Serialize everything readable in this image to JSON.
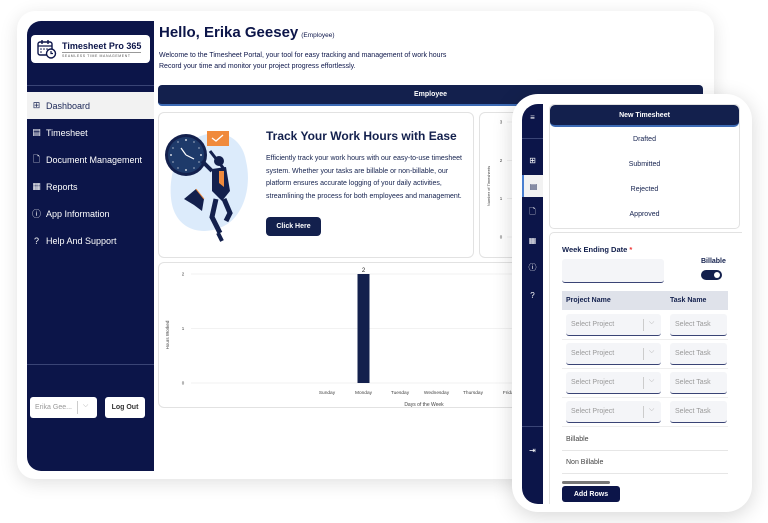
{
  "app": {
    "logo_title": "Timesheet Pro 365",
    "logo_subtitle": "SEAMLESS TIME MANAGEMENT"
  },
  "sidebar": {
    "items": [
      {
        "label": "Dashboard",
        "icon": "dashboard-icon",
        "active": true
      },
      {
        "label": "Timesheet",
        "icon": "timesheet-icon",
        "active": false
      },
      {
        "label": "Document Management",
        "icon": "document-icon",
        "active": false
      },
      {
        "label": "Reports",
        "icon": "reports-icon",
        "active": false
      },
      {
        "label": "App Information",
        "icon": "info-icon",
        "active": false
      },
      {
        "label": "Help And Support",
        "icon": "help-icon",
        "active": false
      }
    ],
    "user_select_value": "Erika Gee...",
    "logout_label": "Log Out"
  },
  "header": {
    "greeting": "Hello, Erika Geesey",
    "role": "(Employee)",
    "welcome_line1": "Welcome to the Timesheet Portal, your tool for easy tracking and management of work hours",
    "welcome_line2": "Record your time and monitor your project progress effortlessly."
  },
  "employee_bar": "Employee",
  "hero": {
    "title": "Track Your Work Hours with Ease",
    "text": "Efficiently track your work hours with our easy-to-use timesheet system. Whether your tasks are billable or non-billable, our platform ensures accurate logging of your daily activities, streamlining the process for both employees and management.",
    "button": "Click Here"
  },
  "chart_data": [
    {
      "type": "bar",
      "title": "",
      "xlabel": "Days of the Week",
      "ylabel": "Hours Worked",
      "categories": [
        "Sunday",
        "Monday",
        "Tuesday",
        "Wednesday",
        "Thursday",
        "Friday"
      ],
      "values": [
        0,
        2,
        0,
        0,
        0,
        0
      ],
      "data_labels": [
        "",
        "2",
        "",
        "",
        "",
        ""
      ],
      "yticks": [
        0,
        1,
        2
      ],
      "ylim": [
        0,
        2
      ],
      "grid": true,
      "bar_color": "#13204d"
    },
    {
      "type": "bar",
      "title": "",
      "ylabel": "Number of Timesheets",
      "yticks": [
        0,
        1,
        2,
        3
      ],
      "ylim": [
        0,
        3
      ],
      "grid": true,
      "categories": [],
      "values": []
    }
  ],
  "mobile": {
    "new_timesheet": "New Timesheet",
    "statuses": [
      "Drafted",
      "Submitted",
      "Rejected",
      "Approved"
    ],
    "week_ending_label": "Week Ending Date",
    "required_mark": "*",
    "week_ending_value": "",
    "billable_label": "Billable",
    "billable_on": true,
    "columns": [
      "Project Name",
      "Task Name"
    ],
    "rows": [
      {
        "project_placeholder": "Select Project",
        "task_placeholder": "Select Task"
      },
      {
        "project_placeholder": "Select Project",
        "task_placeholder": "Select Task"
      },
      {
        "project_placeholder": "Select Project",
        "task_placeholder": "Select Task"
      },
      {
        "project_placeholder": "Select Project",
        "task_placeholder": "Select Task"
      }
    ],
    "list": [
      "Billable",
      "Non Billable"
    ],
    "add_rows": "Add Rows",
    "side_icons": [
      "menu-icon",
      "dashboard-icon",
      "timesheet-icon",
      "document-icon",
      "reports-icon",
      "info-icon",
      "help-icon",
      "logout-icon"
    ]
  },
  "colors": {
    "navy": "#0c1549",
    "accent": "#13204d",
    "highlight": "#f2f2f2",
    "orange": "#f08a3c"
  }
}
